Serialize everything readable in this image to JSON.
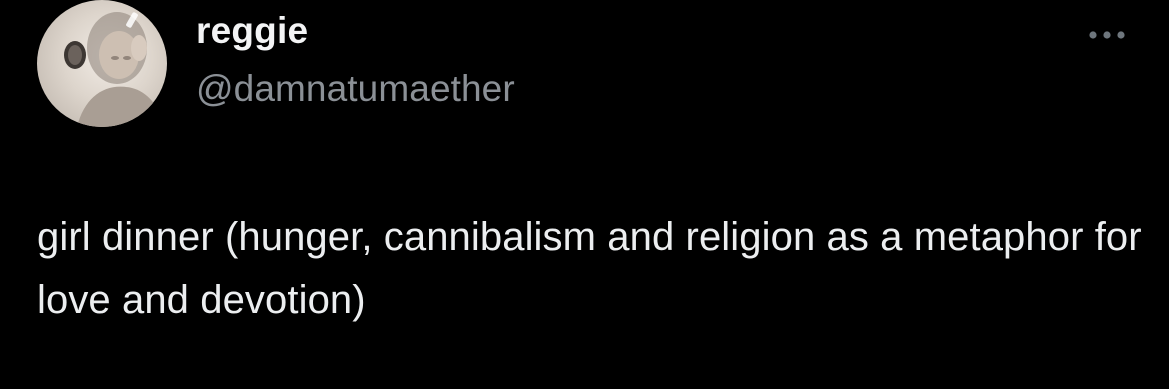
{
  "author": {
    "display_name": "reggie",
    "handle": "@damnatumaether"
  },
  "tweet": {
    "text": "girl dinner (hunger, cannibalism and religion as a metaphor for love and devotion)"
  },
  "icons": {
    "more": "more-horizontal-icon",
    "avatar": "profile-photo"
  },
  "colors": {
    "background": "#000000",
    "primary_text": "#e7e9ea",
    "secondary_text": "#8b9096"
  }
}
